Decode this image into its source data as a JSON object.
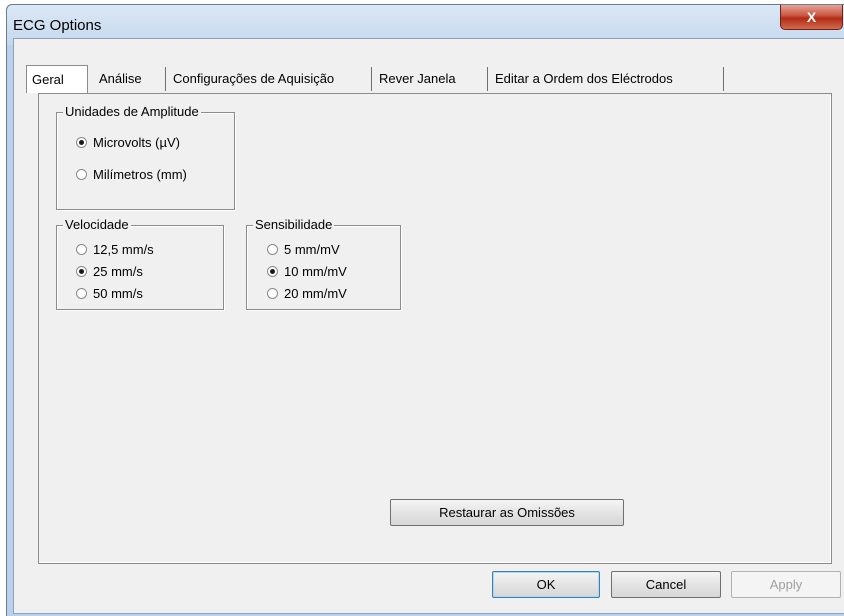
{
  "window": {
    "title": "ECG Options",
    "close_glyph": "X"
  },
  "tabs": [
    {
      "label": "Geral",
      "active": true
    },
    {
      "label": "Análise",
      "active": false
    },
    {
      "label": "Configurações de Aquisição",
      "active": false
    },
    {
      "label": "Rever Janela",
      "active": false
    },
    {
      "label": "Editar a Ordem dos Eléctrodos",
      "active": false
    }
  ],
  "amplitude": {
    "title": "Unidades de Amplitude",
    "options": [
      {
        "label": "Microvolts (µV)",
        "checked": true
      },
      {
        "label": "Milímetros (mm)",
        "checked": false
      }
    ]
  },
  "speed": {
    "title": "Velocidade",
    "options": [
      {
        "label": "12,5 mm/s",
        "checked": false
      },
      {
        "label": "25 mm/s",
        "checked": true
      },
      {
        "label": "50 mm/s",
        "checked": false
      }
    ]
  },
  "sensitivity": {
    "title": "Sensibilidade",
    "options": [
      {
        "label": "5 mm/mV",
        "checked": false
      },
      {
        "label": "10 mm/mV",
        "checked": true
      },
      {
        "label": "20 mm/mV",
        "checked": false
      }
    ]
  },
  "buttons": {
    "restore": "Restaurar as Omissões",
    "ok": "OK",
    "cancel": "Cancel",
    "apply": "Apply"
  }
}
